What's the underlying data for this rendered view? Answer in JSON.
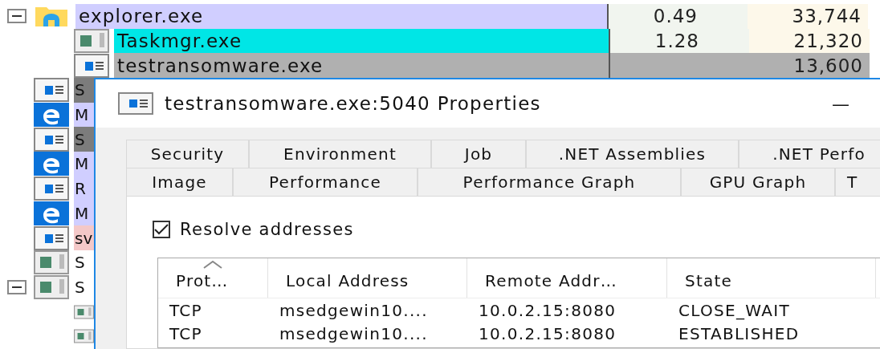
{
  "processes": [
    {
      "name": "explorer.exe",
      "kind": "folder",
      "color": "#d0ceff",
      "expanded": true,
      "suspended": false,
      "cpu": "0.49",
      "private_bytes": "33,744",
      "children": [
        {
          "name": "Taskmgr.exe",
          "kind": "console",
          "color": "#00e6e6",
          "suspended": false,
          "cpu": "1.28",
          "private_bytes": "21,320"
        },
        {
          "name": "testransomware.exe",
          "kind": "window",
          "color": "#b0b0b0",
          "suspended": true,
          "private_bytes": "13,600"
        }
      ]
    },
    {
      "name": "S",
      "kind": "window",
      "color": "#7c7c7c"
    },
    {
      "name": "M",
      "kind": "edge",
      "color": "#d0ceff"
    },
    {
      "name": "S",
      "kind": "window",
      "color": "#7c7c7c"
    },
    {
      "name": "M",
      "kind": "edge",
      "color": "#d0ceff"
    },
    {
      "name": "R",
      "kind": "window",
      "color": "#d0ceff"
    },
    {
      "name": "M",
      "kind": "edge",
      "color": "#d0ceff"
    },
    {
      "name": "sv",
      "kind": "window",
      "color": "#f4c8c8"
    },
    {
      "name": "S",
      "kind": "console",
      "color": "#ffffff"
    },
    {
      "name": "S",
      "kind": "console",
      "color": "#ffffff",
      "expanded": true,
      "children": [
        {
          "kind": "console"
        },
        {
          "kind": "console"
        }
      ]
    }
  ],
  "dialog": {
    "title": "testransomware.exe:5040 Properties",
    "minimize": "—",
    "tab_rows": [
      [
        {
          "label": "Security",
          "selected": false
        },
        {
          "label": "Environment",
          "selected": false
        },
        {
          "label": "Job",
          "selected": false
        },
        {
          "label": ".NET Assemblies",
          "selected": false
        },
        {
          "label": ".NET Perfo",
          "selected": false
        }
      ],
      [
        {
          "label": "Image",
          "selected": false
        },
        {
          "label": "Performance",
          "selected": false
        },
        {
          "label": "Performance Graph",
          "selected": false
        },
        {
          "label": "GPU Graph",
          "selected": false
        },
        {
          "label": "T",
          "selected": false
        }
      ]
    ],
    "resolve_addresses": {
      "label": "Resolve addresses",
      "checked": true
    },
    "connections": {
      "columns": [
        {
          "label": "Prot…",
          "sorted": true
        },
        {
          "label": "Local Address",
          "sorted": false
        },
        {
          "label": "Remote Addr…",
          "sorted": false
        },
        {
          "label": "State",
          "sorted": false
        }
      ],
      "rows": [
        [
          "TCP",
          "msedgewin10....",
          "10.0.2.15:8080",
          "CLOSE_WAIT"
        ],
        [
          "TCP",
          "msedgewin10....",
          "10.0.2.15:8080",
          "ESTABLISHED"
        ]
      ]
    }
  }
}
